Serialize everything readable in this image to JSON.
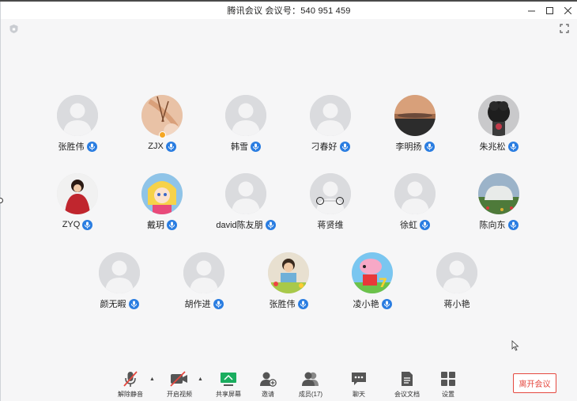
{
  "window": {
    "title": "腾讯会议 会议号：540 951 459",
    "controls": [
      "minimize",
      "maximize",
      "close"
    ]
  },
  "participants": [
    {
      "name": "张胜伟",
      "avatar": "default",
      "mic": true
    },
    {
      "name": "ZJX",
      "avatar": "photo",
      "mic": true,
      "host": true
    },
    {
      "name": "韩雪",
      "avatar": "default",
      "mic": true
    },
    {
      "name": "刁春好",
      "avatar": "default",
      "mic": true
    },
    {
      "name": "李明扬",
      "avatar": "photo",
      "mic": true
    },
    {
      "name": "朱兆松",
      "avatar": "photo",
      "mic": true
    },
    {
      "name": "ZYQ",
      "avatar": "photo",
      "mic": true
    },
    {
      "name": "戴玥",
      "avatar": "photo",
      "mic": true
    },
    {
      "name": "david陈友朋",
      "avatar": "default",
      "mic": true
    },
    {
      "name": "蒋贤维",
      "avatar": "default",
      "mic": false
    },
    {
      "name": "徐虹",
      "avatar": "default",
      "mic": true
    },
    {
      "name": "陈向东",
      "avatar": "photo",
      "mic": true
    },
    {
      "name": "颜无暇",
      "avatar": "default",
      "mic": true
    },
    {
      "name": "胡作进",
      "avatar": "default",
      "mic": true
    },
    {
      "name": "张胜伟",
      "avatar": "photo",
      "mic": true
    },
    {
      "name": "凌小艳",
      "avatar": "photo",
      "mic": true
    },
    {
      "name": "蒋小艳",
      "avatar": "default",
      "mic": false
    }
  ],
  "toolbar": {
    "unmute": "解除静音",
    "start_video": "开启视频",
    "share_screen": "共享屏幕",
    "invite": "邀请",
    "members": "成员(17)",
    "chat": "聊天",
    "docs": "会议文档",
    "settings": "设置",
    "leave": "离开会议"
  },
  "colors": {
    "mic_blue": "#2a7de1",
    "leave_red": "#e5483f",
    "share_green": "#1aad5f",
    "muted_red": "#e5483f"
  }
}
